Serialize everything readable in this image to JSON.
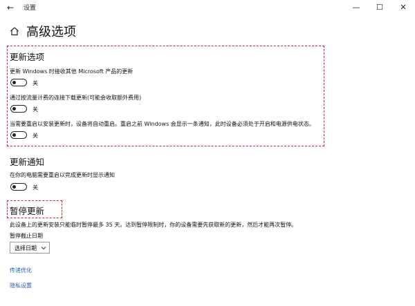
{
  "window": {
    "title": "设置",
    "back_glyph": "←",
    "minimize_glyph": "—",
    "maximize_glyph": "☐",
    "close_glyph": "✕"
  },
  "page": {
    "title": "高级选项"
  },
  "update_options": {
    "title": "更新选项",
    "settings": [
      {
        "label": "更新 Windows 时接收其他 Microsoft 产品的更新",
        "state": "关"
      },
      {
        "label": "通过按流量计费的连接下载更新(可能会收取额外费用)",
        "state": "关"
      },
      {
        "label": "当需要重启以安装更新时，设备将自动重启。重启之前 Windows 会显示一条通知，此时设备必须处于开启和电源供电状态。",
        "state": "关"
      }
    ]
  },
  "update_notify": {
    "title": "更新通知",
    "settings": [
      {
        "label": "在你的电脑需要重启以完成更新时显示通知",
        "state": "关"
      }
    ]
  },
  "pause_updates": {
    "title": "暂停更新",
    "description": "此设备上的更新安装只能临时暂停最多 35 天。达到暂停限制时，你的设备需要先获取新的更新，然后才能再次暂停。",
    "date_label": "暂停截止日期",
    "date_select": "选择日期"
  },
  "links": {
    "delivery_optimization": "传递优化",
    "privacy_settings": "隐私设置"
  },
  "colors": {
    "highlight": "#d21f2b",
    "link": "#1a5fb4"
  }
}
